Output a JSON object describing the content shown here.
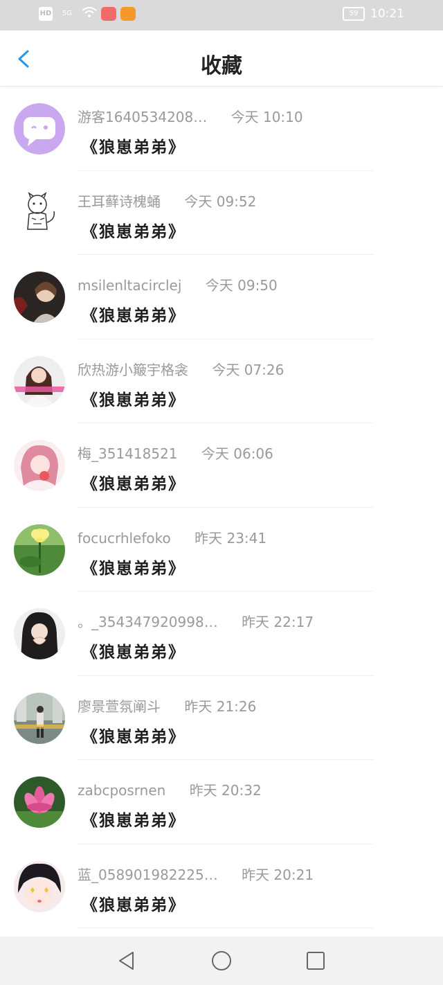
{
  "status_bar": {
    "hd": "HD",
    "signal": "5G",
    "battery": "59",
    "time": "10:21"
  },
  "header": {
    "title": "收藏",
    "back_icon": "chevron-left-icon",
    "accent_color": "#2196f3"
  },
  "items": [
    {
      "name": "游客1640534208…",
      "time": "今天 10:10",
      "content": "《狼崽弟弟》",
      "avatar": "cartoon-chat-avatar"
    },
    {
      "name": "王耳藓诗槐蛹",
      "time": "今天 09:52",
      "content": "《狼崽弟弟》",
      "avatar": "tiger-sketch-avatar"
    },
    {
      "name": "msilenltacirclej",
      "time": "今天 09:50",
      "content": "《狼崽弟弟》",
      "avatar": "anime-boy-avatar"
    },
    {
      "name": "欣热游小簸宇格衾",
      "time": "今天 07:26",
      "content": "《狼崽弟弟》",
      "avatar": "girl-photo-avatar"
    },
    {
      "name": "梅_351418521",
      "time": "今天 06:06",
      "content": "《狼崽弟弟》",
      "avatar": "pink-anime-avatar"
    },
    {
      "name": "focucrhlefoko",
      "time": "昨天 23:41",
      "content": "《狼崽弟弟》",
      "avatar": "yellow-flower-avatar"
    },
    {
      "name": "。_354347920998…",
      "time": "昨天 22:17",
      "content": "《狼崽弟弟》",
      "avatar": "girl-heart-avatar"
    },
    {
      "name": "廖景萱氛阐斗",
      "time": "昨天 21:26",
      "content": "《狼崽弟弟》",
      "avatar": "street-photo-avatar"
    },
    {
      "name": "zabcposrnen",
      "time": "昨天 20:32",
      "content": "《狼崽弟弟》",
      "avatar": "lotus-avatar"
    },
    {
      "name": "蓝_058901982225…",
      "time": "昨天 20:21",
      "content": "《狼崽弟弟》",
      "avatar": "anime-girl-avatar"
    }
  ],
  "nav_bar": {
    "back_icon": "triangle-back-icon",
    "home_icon": "circle-home-icon",
    "recents_icon": "square-recents-icon"
  }
}
